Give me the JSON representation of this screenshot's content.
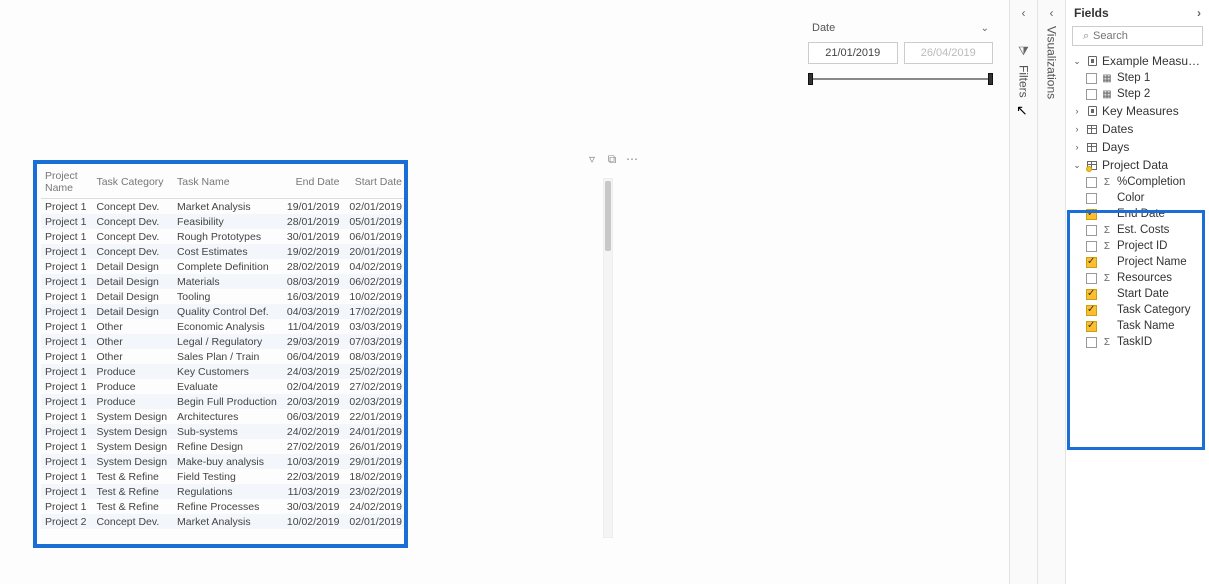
{
  "slicer": {
    "label": "Date",
    "start": "21/01/2019",
    "end": "26/04/2019"
  },
  "panes": {
    "filters": "Filters",
    "visualizations": "Visualizations",
    "fields": "Fields",
    "search_placeholder": "Search"
  },
  "tree": {
    "t0": {
      "label": "Example Measures"
    },
    "t0_items": [
      "Step 1",
      "Step 2"
    ],
    "t1": {
      "label": "Key Measures"
    },
    "t2": {
      "label": "Dates"
    },
    "t3": {
      "label": "Days"
    },
    "t4": {
      "label": "Project Data"
    },
    "t4_fields": [
      {
        "label": "%Completion",
        "checked": false,
        "sigma": true
      },
      {
        "label": "Color",
        "checked": false,
        "sigma": false
      },
      {
        "label": "End Date",
        "checked": true,
        "sigma": false
      },
      {
        "label": "Est. Costs",
        "checked": false,
        "sigma": true
      },
      {
        "label": "Project ID",
        "checked": false,
        "sigma": true
      },
      {
        "label": "Project Name",
        "checked": true,
        "sigma": false
      },
      {
        "label": "Resources",
        "checked": false,
        "sigma": true
      },
      {
        "label": "Start Date",
        "checked": true,
        "sigma": false
      },
      {
        "label": "Task Category",
        "checked": true,
        "sigma": false
      },
      {
        "label": "Task Name",
        "checked": true,
        "sigma": false
      },
      {
        "label": "TaskID",
        "checked": false,
        "sigma": true
      }
    ]
  },
  "table": {
    "headers": [
      "Project Name",
      "Task Category",
      "Task Name",
      "End Date",
      "Start Date"
    ],
    "rows": [
      [
        "Project 1",
        "Concept Dev.",
        "Market Analysis",
        "19/01/2019",
        "02/01/2019"
      ],
      [
        "Project 1",
        "Concept Dev.",
        "Feasibility",
        "28/01/2019",
        "05/01/2019"
      ],
      [
        "Project 1",
        "Concept Dev.",
        "Rough Prototypes",
        "30/01/2019",
        "06/01/2019"
      ],
      [
        "Project 1",
        "Concept Dev.",
        "Cost Estimates",
        "19/02/2019",
        "20/01/2019"
      ],
      [
        "Project 1",
        "Detail Design",
        "Complete Definition",
        "28/02/2019",
        "04/02/2019"
      ],
      [
        "Project 1",
        "Detail Design",
        "Materials",
        "08/03/2019",
        "06/02/2019"
      ],
      [
        "Project 1",
        "Detail Design",
        "Tooling",
        "16/03/2019",
        "10/02/2019"
      ],
      [
        "Project 1",
        "Detail Design",
        "Quality Control Def.",
        "04/03/2019",
        "17/02/2019"
      ],
      [
        "Project 1",
        "Other",
        "Economic Analysis",
        "11/04/2019",
        "03/03/2019"
      ],
      [
        "Project 1",
        "Other",
        "Legal / Regulatory",
        "29/03/2019",
        "07/03/2019"
      ],
      [
        "Project 1",
        "Other",
        "Sales Plan / Train",
        "06/04/2019",
        "08/03/2019"
      ],
      [
        "Project 1",
        "Produce",
        "Key Customers",
        "24/03/2019",
        "25/02/2019"
      ],
      [
        "Project 1",
        "Produce",
        "Evaluate",
        "02/04/2019",
        "27/02/2019"
      ],
      [
        "Project 1",
        "Produce",
        "Begin Full Production",
        "20/03/2019",
        "02/03/2019"
      ],
      [
        "Project 1",
        "System Design",
        "Architectures",
        "06/03/2019",
        "22/01/2019"
      ],
      [
        "Project 1",
        "System Design",
        "Sub-systems",
        "24/02/2019",
        "24/01/2019"
      ],
      [
        "Project 1",
        "System Design",
        "Refine Design",
        "27/02/2019",
        "26/01/2019"
      ],
      [
        "Project 1",
        "System Design",
        "Make-buy analysis",
        "10/03/2019",
        "29/01/2019"
      ],
      [
        "Project 1",
        "Test & Refine",
        "Field Testing",
        "22/03/2019",
        "18/02/2019"
      ],
      [
        "Project 1",
        "Test & Refine",
        "Regulations",
        "11/03/2019",
        "23/02/2019"
      ],
      [
        "Project 1",
        "Test & Refine",
        "Refine Processes",
        "30/03/2019",
        "24/02/2019"
      ],
      [
        "Project 2",
        "Concept Dev.",
        "Market Analysis",
        "10/02/2019",
        "02/01/2019"
      ]
    ]
  }
}
